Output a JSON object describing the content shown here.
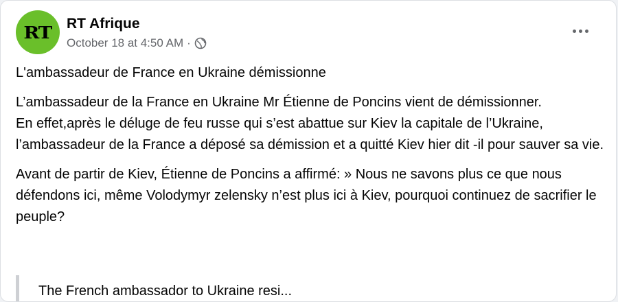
{
  "post": {
    "author": "RT Afrique",
    "avatar_text": "RT",
    "timestamp": "October 18 at 4:50 AM",
    "separator": "·",
    "privacy_icon": "globe-icon",
    "more_icon": "more-options-icon"
  },
  "content": {
    "headline": "L'ambassadeur de France en Ukraine démissionne",
    "paragraph1_line1": "L’ambassadeur de la France en Ukraine Mr Étienne de Poncins vient de démissionner.",
    "paragraph1_line2": "En effet,après le déluge de feu russe qui s’est abattue sur Kiev la capitale de l’Ukraine, l’ambassadeur de la France a déposé sa démission et a quitté Kiev hier dit -il pour sauver sa vie.",
    "paragraph2": "Avant de partir de Kiev, Étienne de Poncins a affirmé: » Nous ne savons plus ce que nous défendons ici, même Volodymyr zelensky n’est plus ici à Kiev, pourquoi continuez de sacrifier le peuple?",
    "quote_partial": "The French ambassador to Ukraine resi..."
  },
  "colors": {
    "avatar_bg": "#6abf2a",
    "secondary_text": "#65676b",
    "quote_bar": "#ced0d4"
  }
}
